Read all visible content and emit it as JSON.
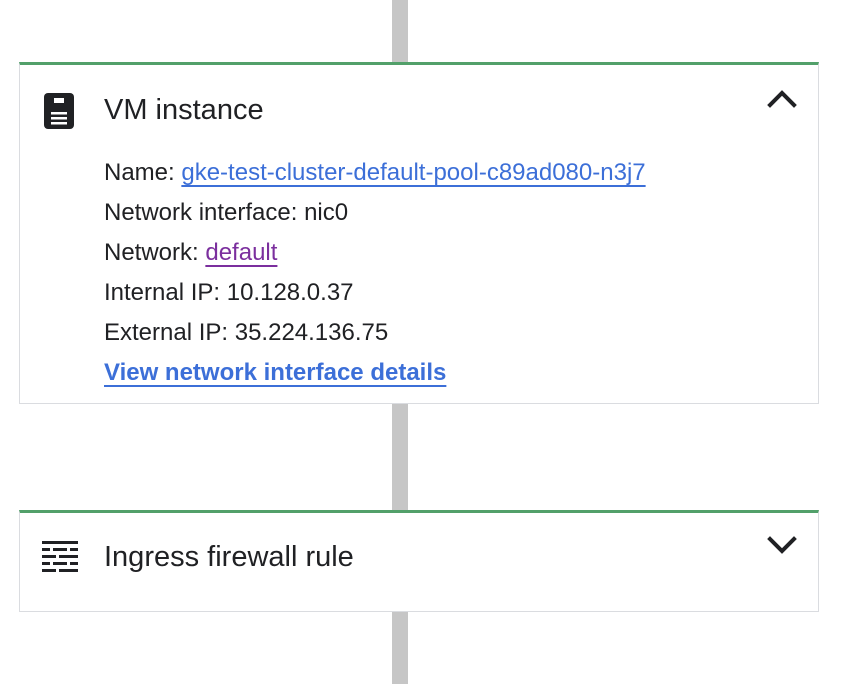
{
  "vm_card": {
    "title": "VM instance",
    "icon": "vm-instance-icon",
    "expanded": true,
    "name_label": "Name: ",
    "name_value": "gke-test-cluster-default-pool-c89ad080-n3j7",
    "network_interface_label": "Network interface: ",
    "network_interface_value": "nic0",
    "network_label": "Network: ",
    "network_value": "default",
    "internal_ip_label": "Internal IP: ",
    "internal_ip_value": "10.128.0.37",
    "external_ip_label": "External IP: ",
    "external_ip_value": "35.224.136.75",
    "details_link": "View network interface details"
  },
  "firewall_card": {
    "title": "Ingress firewall rule",
    "icon": "firewall-icon",
    "expanded": false
  },
  "colors": {
    "card_accent": "#52a06a",
    "link_blue": "#3c6fd8",
    "link_visited": "#7b2f9e",
    "connector": "#c6c6c6"
  }
}
